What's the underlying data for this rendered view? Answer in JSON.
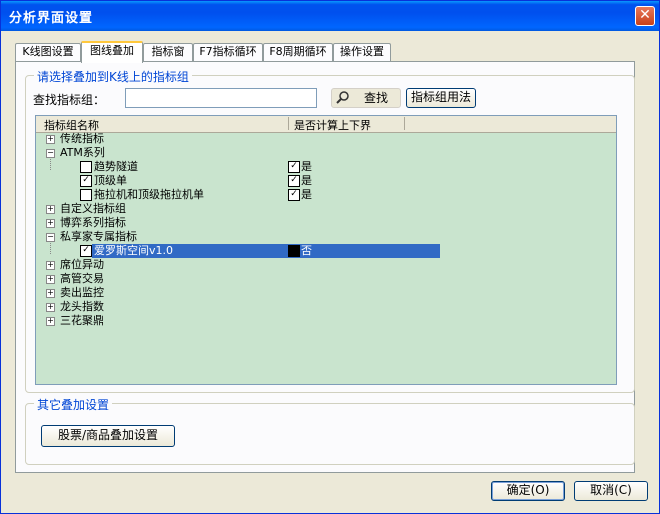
{
  "window": {
    "title": "分析界面设置",
    "close_glyph": "✕"
  },
  "tabs": [
    "K线图设置",
    "图线叠加",
    "指标窗",
    "F7指标循环",
    "F8周期循环",
    "操作设置"
  ],
  "overlay_group": {
    "legend": "请选择叠加到K线上的指标组",
    "search_label": "查找指标组：",
    "search_value": "",
    "search_button": "查找",
    "usage_button": "指标组用法"
  },
  "list": {
    "columns": [
      "指标组名称",
      "是否计算上下界"
    ],
    "collapsed_glyph": "+",
    "expanded_glyph": "−",
    "check_glyph": "✓",
    "rows": [
      {
        "name": "传统指标"
      },
      {
        "name": "ATM系列"
      },
      {
        "name": "趋势隧道",
        "flag": "是"
      },
      {
        "name": "顶级单",
        "flag": "是"
      },
      {
        "name": "拖拉机和顶级拖拉机单",
        "flag": "是"
      },
      {
        "name": "自定义指标组"
      },
      {
        "name": "博弈系列指标"
      },
      {
        "name": "私享家专属指标"
      },
      {
        "name": "爱罗斯空间v1.0",
        "flag": "否"
      },
      {
        "name": "席位异动"
      },
      {
        "name": "高管交易"
      },
      {
        "name": "卖出监控"
      },
      {
        "name": "龙头指数"
      },
      {
        "name": "三花聚鼎"
      }
    ]
  },
  "other_group": {
    "legend": "其它叠加设置",
    "stock_button": "股票/商品叠加设置"
  },
  "footer": {
    "ok": "确定(O)",
    "cancel": "取消(C)"
  }
}
